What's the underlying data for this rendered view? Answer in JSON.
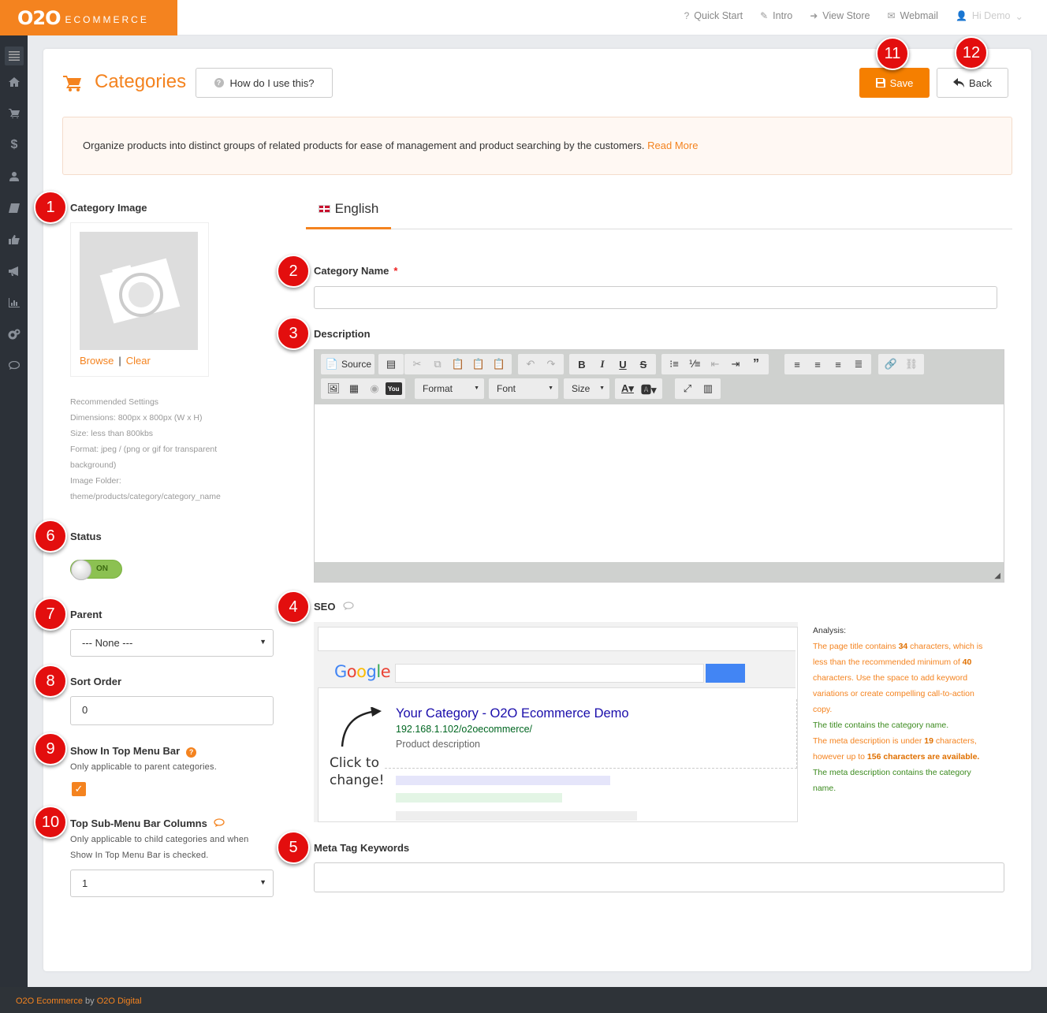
{
  "brand": {
    "logo_big": "O2O",
    "logo_small": "ECOMMERCE",
    "accent": "#f4831f"
  },
  "topnav": {
    "quick_start": "Quick Start",
    "intro": "Intro",
    "view_store": "View Store",
    "webmail": "Webmail",
    "user": "Hi Demo"
  },
  "page": {
    "title": "Categories",
    "help_button": "How do I use this?",
    "save": "Save",
    "back": "Back"
  },
  "info": {
    "text": "Organize products into distinct groups of related products for ease of management and product searching by the customers. ",
    "read_more": "Read More"
  },
  "badges": [
    "1",
    "2",
    "3",
    "4",
    "5",
    "6",
    "7",
    "8",
    "9",
    "10",
    "11",
    "12"
  ],
  "left": {
    "image_label": "Category Image",
    "browse": "Browse",
    "sep": "|",
    "clear": "Clear",
    "recommended": [
      "Recommended Settings",
      "Dimensions: 800px x 800px (W x H)",
      "Size: less than 800kbs",
      "Format: jpeg / (png or gif for transparent",
      "background)",
      "Image Folder:",
      "theme/products/category/category_name"
    ],
    "status_label": "Status",
    "status_value": "ON",
    "parent_label": "Parent",
    "parent_value": "--- None ---",
    "sort_label": "Sort Order",
    "sort_value": "0",
    "top_menu_label": "Show In Top Menu Bar",
    "top_menu_help": "Only applicable to parent categories.",
    "top_menu_checked": true,
    "submenu_label": "Top Sub-Menu Bar Columns",
    "submenu_help_1": "Only applicable to child categories and when",
    "submenu_help_2": "Show In Top Menu Bar is checked.",
    "submenu_value": "1"
  },
  "right": {
    "tab": "English",
    "name_label": "Category Name",
    "required": "*",
    "name_value": "",
    "desc_label": "Description",
    "editor": {
      "source": "Source",
      "format": "Format",
      "font": "Font",
      "size": "Size"
    },
    "seo_label": "SEO",
    "seo_preview": {
      "google": "Google",
      "title": "Your Category - O2O Ecommerce Demo",
      "url": "192.168.1.102/o2oecommerce/",
      "desc": "Product description",
      "click1": "Click to",
      "click2": "change!"
    },
    "analysis": {
      "heading": "Analysis:",
      "l1a": "The page title contains ",
      "n1": "34",
      "l1b": " characters, which is",
      "l2a": "less than the recommended minimum of ",
      "n2": "40",
      "l3": "characters. Use the space to add keyword",
      "l4": "variations or create compelling call-to-action",
      "l5": "copy.",
      "l6": "The title contains the category name.",
      "l7a": "The meta description is under ",
      "n3": "19",
      "l7b": " characters,",
      "l8a": "however up to ",
      "n4": "156 characters are available.",
      "l9": "The meta description contains the category",
      "l10": "name."
    },
    "meta_label": "Meta Tag Keywords",
    "meta_value": ""
  },
  "footer": {
    "a": "O2O Ecommerce",
    "by": " by ",
    "b": "O2O Digital"
  }
}
